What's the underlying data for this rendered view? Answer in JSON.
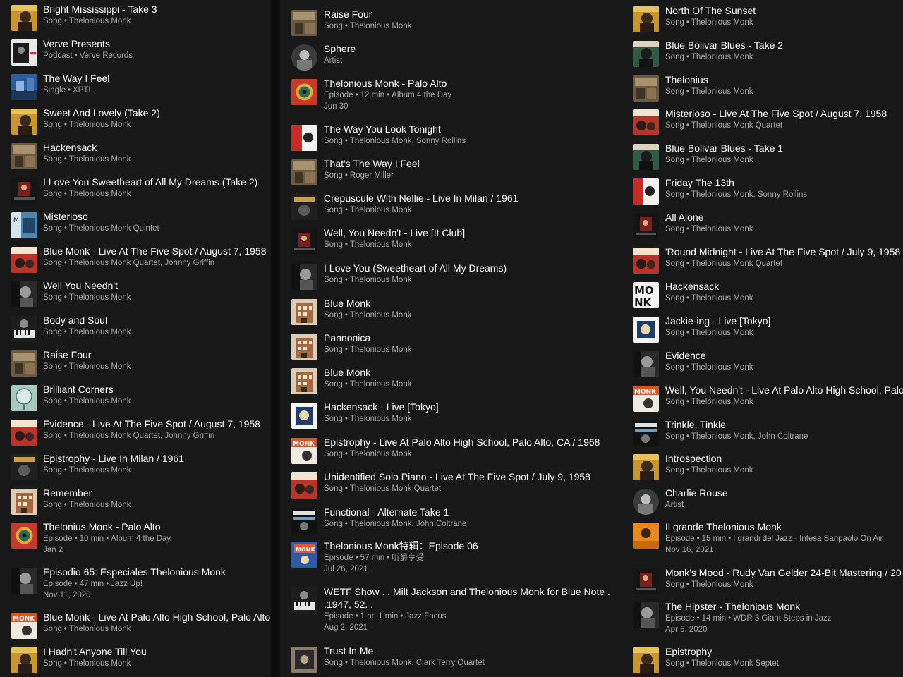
{
  "colors": {
    "background": "#121212",
    "panel": "#181818",
    "title": "#ffffff",
    "subtitle": "#a7a7a7"
  },
  "columns": [
    {
      "items": [
        {
          "title": "Bright Mississippi - Take 3",
          "type": "Song",
          "by": "Thelonious Monk",
          "art": "portrait-gold"
        },
        {
          "title": "Verve Presents",
          "type": "Podcast",
          "by": "Verve Records",
          "art": "verve"
        },
        {
          "title": "The Way I Feel",
          "type": "Single",
          "by": "XPTL",
          "art": "blue-scene"
        },
        {
          "title": "Sweet And Lovely (Take 2)",
          "type": "Song",
          "by": "Thelonious Monk",
          "art": "portrait-gold"
        },
        {
          "title": "Hackensack",
          "type": "Song",
          "by": "Thelonious Monk",
          "art": "brown-room"
        },
        {
          "title": "I Love You Sweetheart of All My Dreams (Take 2)",
          "type": "Song",
          "by": "Thelonious Monk",
          "art": "dark-red"
        },
        {
          "title": "Misterioso",
          "type": "Song",
          "by": "Thelonious Monk Quintet",
          "art": "blue-mono"
        },
        {
          "title": "Blue Monk - Live At The Five Spot / August 7, 1958",
          "type": "Song",
          "by": "Thelonious Monk Quartet, Johnny Griffin",
          "art": "five-spot"
        },
        {
          "title": "Well You Needn't",
          "type": "Song",
          "by": "Thelonious Monk",
          "art": "bw-portrait"
        },
        {
          "title": "Body and Soul",
          "type": "Song",
          "by": "Thelonious Monk",
          "art": "bw-piano"
        },
        {
          "title": "Raise Four",
          "type": "Song",
          "by": "Thelonious Monk",
          "art": "brown-room"
        },
        {
          "title": "Brilliant Corners",
          "type": "Song",
          "by": "Thelonious Monk",
          "art": "teal-glass"
        },
        {
          "title": "Evidence - Live At The Five Spot / August 7, 1958",
          "type": "Song",
          "by": "Thelonious Monk Quartet, Johnny Griffin",
          "art": "five-spot"
        },
        {
          "title": "Epistrophy - Live In Milan / 1961",
          "type": "Song",
          "by": "Thelonious Monk",
          "art": "dark-milan"
        },
        {
          "title": "Remember",
          "type": "Song",
          "by": "Thelonious Monk",
          "art": "building"
        },
        {
          "title": "Thelonius Monk - Palo Alto",
          "type": "Episode",
          "by": "10 min",
          "extra": "Album 4 the Day",
          "date": "Jan 2",
          "art": "album4day"
        },
        {
          "title": "Episodio 65: Especiales Thelonious Monk",
          "type": "Episode",
          "by": "47 min",
          "extra": "Jazz Up!",
          "date": "Nov 11, 2020",
          "art": "bw-portrait"
        },
        {
          "title": "Blue Monk - Live At Palo Alto High School, Palo Alto",
          "type": "Song",
          "by": "Thelonious Monk",
          "art": "monk-orange"
        },
        {
          "title": "I Hadn't Anyone Till You",
          "type": "Song",
          "by": "Thelonious Monk",
          "art": "portrait-gold"
        }
      ]
    },
    {
      "items": [
        {
          "title": "Raise Four",
          "type": "Song",
          "by": "Thelonious Monk",
          "art": "brown-room"
        },
        {
          "title": "Sphere",
          "type": "Artist",
          "art": "artist-bw"
        },
        {
          "title": "Thelonious Monk - Palo Alto",
          "type": "Episode",
          "by": "12 min",
          "extra": "Album 4 the Day",
          "date": "Jun 30",
          "art": "album4day"
        },
        {
          "title": "The Way You Look Tonight",
          "type": "Song",
          "by": "Thelonious Monk, Sonny Rollins",
          "art": "red-white"
        },
        {
          "title": "That's The Way I Feel",
          "type": "Song",
          "by": "Roger Miller",
          "art": "brown-room"
        },
        {
          "title": "Crepuscule With Nellie - Live In Milan / 1961",
          "type": "Song",
          "by": "Thelonious Monk",
          "art": "dark-milan"
        },
        {
          "title": "Well, You Needn't - Live [It Club]",
          "type": "Song",
          "by": "Thelonious Monk",
          "art": "dark-red"
        },
        {
          "title": "I Love You (Sweetheart of All My Dreams)",
          "type": "Song",
          "by": "Thelonious Monk",
          "art": "bw-portrait"
        },
        {
          "title": "Blue Monk",
          "type": "Song",
          "by": "Thelonious Monk",
          "art": "building"
        },
        {
          "title": "Pannonica",
          "type": "Song",
          "by": "Thelonious Monk",
          "art": "building"
        },
        {
          "title": "Blue Monk",
          "type": "Song",
          "by": "Thelonious Monk",
          "art": "building"
        },
        {
          "title": "Hackensack - Live [Tokyo]",
          "type": "Song",
          "by": "Thelonious Monk",
          "art": "tokyo"
        },
        {
          "title": "Epistrophy - Live At Palo Alto High School, Palo Alto, CA / 1968",
          "type": "Song",
          "by": "Thelonious Monk",
          "art": "monk-orange"
        },
        {
          "title": "Unidentified Solo Piano - Live At The Five Spot / July 9, 1958",
          "type": "Song",
          "by": "Thelonious Monk Quartet",
          "art": "five-spot"
        },
        {
          "title": "Functional - Alternate Take 1",
          "type": "Song",
          "by": "Thelonious Monk, John Coltrane",
          "art": "coltrane"
        },
        {
          "title": "Thelonious Monk特辑：Episode 06",
          "type": "Episode",
          "by": "57 min",
          "extra": "听爵享受",
          "date": "Jul 26, 2021",
          "art": "monk-blue"
        },
        {
          "title": "WETF Show . . Milt Jackson and Thelonious Monk for Blue Note .",
          "title2": ".1947, 52. .",
          "type": "Episode",
          "by": "1 hr, 1 min",
          "extra": "Jazz Focus",
          "date": "Aug 2, 2021",
          "art": "bw-piano"
        },
        {
          "title": "Trust In Me",
          "type": "Song",
          "by": "Thelonious Monk, Clark Terry Quartet",
          "art": "clark"
        }
      ]
    },
    {
      "items": [
        {
          "title": "North Of The Sunset",
          "type": "Song",
          "by": "Thelonious Monk",
          "art": "portrait-gold"
        },
        {
          "title": "Blue Bolivar Blues - Take 2",
          "type": "Song",
          "by": "Thelonious Monk",
          "art": "portrait-green"
        },
        {
          "title": "Thelonius",
          "type": "Song",
          "by": "Thelonious Monk",
          "art": "brown-room"
        },
        {
          "title": "Misterioso - Live At The Five Spot / August 7, 1958",
          "type": "Song",
          "by": "Thelonious Monk Quartet",
          "art": "five-spot"
        },
        {
          "title": "Blue Bolivar Blues - Take 1",
          "type": "Song",
          "by": "Thelonious Monk",
          "art": "portrait-green"
        },
        {
          "title": "Friday The 13th",
          "type": "Song",
          "by": "Thelonious Monk, Sonny Rollins",
          "art": "red-white"
        },
        {
          "title": "All Alone",
          "type": "Song",
          "by": "Thelonious Monk",
          "art": "dark-red"
        },
        {
          "title": "'Round Midnight - Live At The Five Spot / July 9, 1958",
          "type": "Song",
          "by": "Thelonious Monk Quartet",
          "art": "five-spot"
        },
        {
          "title": "Hackensack",
          "type": "Song",
          "by": "Thelonious Monk",
          "art": "monk-letters"
        },
        {
          "title": "Jackie-ing - Live [Tokyo]",
          "type": "Song",
          "by": "Thelonious Monk",
          "art": "tokyo"
        },
        {
          "title": "Evidence",
          "type": "Song",
          "by": "Thelonious Monk",
          "art": "bw-portrait"
        },
        {
          "title": "Well, You Needn't - Live At Palo Alto High School, Palo",
          "type": "Song",
          "by": "Thelonious Monk",
          "art": "monk-orange"
        },
        {
          "title": "Trinkle, Tinkle",
          "type": "Song",
          "by": "Thelonious Monk, John Coltrane",
          "art": "coltrane"
        },
        {
          "title": "Introspection",
          "type": "Song",
          "by": "Thelonious Monk",
          "art": "portrait-gold"
        },
        {
          "title": "Charlie Rouse",
          "type": "Artist",
          "art": "artist-bw"
        },
        {
          "title": "Il grande Thelonious Monk",
          "type": "Episode",
          "by": "15 min",
          "extra": "I grandi del Jazz - Intesa Sanpaolo On Air",
          "date": "Nov 16, 2021",
          "art": "orange-podcast"
        },
        {
          "title": "Monk's Mood - Rudy Van Gelder 24-Bit Mastering / 20",
          "type": "Song",
          "by": "Thelonious Monk",
          "art": "dark-red"
        },
        {
          "title": "The Hipster - Thelonious Monk",
          "type": "Episode",
          "by": "14 min",
          "extra": "WDR 3 Giant Steps in Jazz",
          "date": "Apr 5, 2020",
          "art": "bw-portrait"
        },
        {
          "title": "Epistrophy",
          "type": "Song",
          "by": "Thelonious Monk Septet",
          "art": "portrait-gold"
        }
      ]
    }
  ]
}
